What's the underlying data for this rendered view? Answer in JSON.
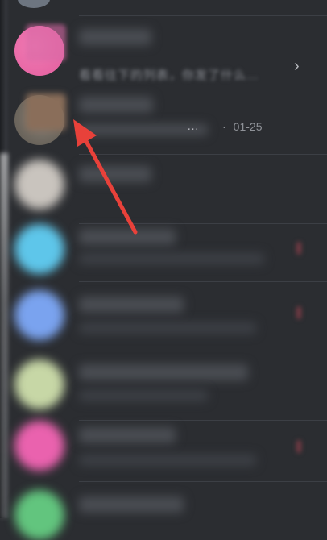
{
  "conversations": [
    {
      "message_preview": "看看往下的列表，你发了什么…",
      "has_chevron": true
    },
    {
      "message_preview": "…",
      "time": "01-25"
    },
    {},
    {},
    {},
    {},
    {},
    {}
  ],
  "icons": {
    "chevron": "chevron-right-icon",
    "pointer": "red-arrow-annotation"
  },
  "colors": {
    "background": "#2b2d31",
    "arrow": "#e8413a"
  }
}
